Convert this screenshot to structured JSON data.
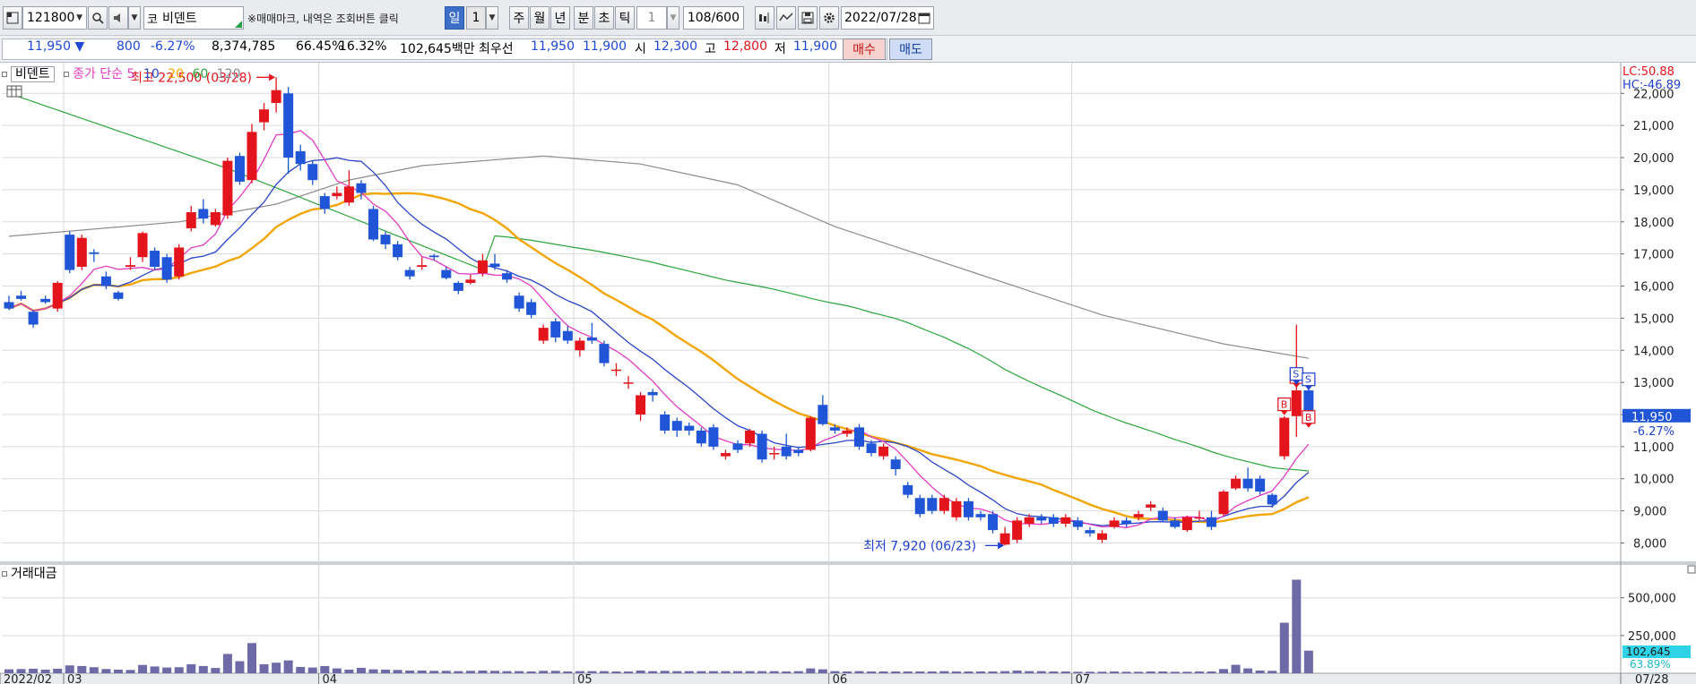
{
  "toolbar": {
    "code": "121800",
    "market_badge": "코",
    "stock_name": "비덴트",
    "mark_text": "매매마크, 내역은 조회버튼 클릭",
    "periods": [
      {
        "label": "일",
        "active": true
      },
      {
        "label": "1",
        "kind": "value"
      },
      {
        "label": "주"
      },
      {
        "label": "월"
      },
      {
        "label": "년"
      },
      {
        "label": "분"
      },
      {
        "label": "초"
      },
      {
        "label": "틱"
      },
      {
        "label": "1",
        "kind": "value-disabled"
      }
    ],
    "count": "108/600",
    "date": "2022/07/28"
  },
  "quote": {
    "price": "11,950",
    "arrow": "▼",
    "change": "800",
    "change_pct": "-6.27%",
    "volume": "8,374,785",
    "ratio1": "66.45%",
    "ratio2": "16.32%",
    "amount": "102,645백만",
    "bid_label": "최우선",
    "bid1": "11,950",
    "bid2": "11,900",
    "open_label": "시",
    "open": "12,300",
    "high_label": "고",
    "high": "12,800",
    "low_label": "저",
    "low": "11,900",
    "buy_label": "매수",
    "sell_label": "매도"
  },
  "legend": {
    "name": "비덴트",
    "ma_label": "종가 단순",
    "periods": [
      "5",
      "10",
      "20",
      "60",
      "120"
    ],
    "volume_label": "거래대금"
  },
  "colors": {
    "up": "#e3141c",
    "down": "#1f55d6",
    "ma5": "#e33cc3",
    "ma10": "#2a45c8",
    "ma20": "#f2a500",
    "ma60": "#2aa53a",
    "ma120": "#8c8c8c",
    "volume": "#6e6aa8"
  },
  "chart_data": {
    "type": "candlestick",
    "y_ticks": [
      "22,000",
      "21,000",
      "20,000",
      "19,000",
      "18,000",
      "17,000",
      "16,000",
      "15,000",
      "14,000",
      "13,000",
      "12,000",
      "11,000",
      "10,000",
      "9,000",
      "8,000"
    ],
    "ylim": [
      7400,
      22900
    ],
    "volume_ticks": [
      "500,000",
      "250,000"
    ],
    "volume_max": 700000,
    "x_labels": [
      {
        "label": "2022/02",
        "i": 0
      },
      {
        "label": "03",
        "i": 5
      },
      {
        "label": "04",
        "i": 26
      },
      {
        "label": "05",
        "i": 47
      },
      {
        "label": "06",
        "i": 68
      },
      {
        "label": "07",
        "i": 88
      },
      {
        "label": "07/28",
        "i": 107
      }
    ],
    "candles": [
      [
        15500,
        15300,
        15700,
        15250
      ],
      [
        15700,
        15600,
        15850,
        15550
      ],
      [
        15200,
        14800,
        15250,
        14700
      ],
      [
        15600,
        15500,
        15700,
        15450
      ],
      [
        15300,
        16100,
        16150,
        15200
      ],
      [
        17600,
        16500,
        17700,
        16400
      ],
      [
        16600,
        17500,
        17600,
        16500
      ],
      [
        17050,
        17000,
        17150,
        16750
      ],
      [
        16300,
        16000,
        16450,
        15900
      ],
      [
        15800,
        15600,
        15850,
        15550
      ],
      [
        16600,
        16650,
        16900,
        16500
      ],
      [
        16900,
        17650,
        17700,
        16750
      ],
      [
        17100,
        16600,
        17200,
        16500
      ],
      [
        16900,
        16200,
        17000,
        16100
      ],
      [
        16300,
        17200,
        17300,
        16200
      ],
      [
        17800,
        18300,
        18500,
        17700
      ],
      [
        18400,
        18100,
        18700,
        17950
      ],
      [
        17900,
        18300,
        18400,
        17850
      ],
      [
        18200,
        19900,
        20000,
        18100
      ],
      [
        20050,
        19250,
        20150,
        19150
      ],
      [
        19300,
        20800,
        21050,
        19200
      ],
      [
        21100,
        21500,
        21700,
        20850
      ],
      [
        21700,
        22100,
        22500,
        21400
      ],
      [
        22000,
        20000,
        22200,
        19500
      ],
      [
        20200,
        19800,
        20400,
        19600
      ],
      [
        19800,
        19300,
        19900,
        19150
      ],
      [
        18800,
        18400,
        18900,
        18250
      ],
      [
        18800,
        18900,
        19100,
        18700
      ],
      [
        18600,
        19100,
        19600,
        18500
      ],
      [
        19200,
        18900,
        19300,
        18700
      ],
      [
        18400,
        17450,
        18500,
        17400
      ],
      [
        17600,
        17300,
        17700,
        17150
      ],
      [
        17300,
        16900,
        17400,
        16800
      ],
      [
        16500,
        16300,
        16600,
        16200
      ],
      [
        16600,
        16650,
        16900,
        16500
      ],
      [
        16950,
        16900,
        17000,
        16800
      ],
      [
        16500,
        16250,
        16600,
        16200
      ],
      [
        16100,
        15850,
        16150,
        15750
      ],
      [
        16100,
        16200,
        16350,
        16050
      ],
      [
        16400,
        16800,
        17000,
        16300
      ],
      [
        16700,
        16600,
        17000,
        16500
      ],
      [
        16400,
        16200,
        16500,
        16100
      ],
      [
        15700,
        15300,
        15800,
        15200
      ],
      [
        15500,
        15100,
        15600,
        15000
      ],
      [
        14300,
        14700,
        14800,
        14200
      ],
      [
        14900,
        14400,
        15000,
        14250
      ],
      [
        14600,
        14300,
        14750,
        14200
      ],
      [
        14000,
        14300,
        14400,
        13800
      ],
      [
        14400,
        14300,
        14850,
        14200
      ],
      [
        14200,
        13600,
        14300,
        13500
      ],
      [
        13400,
        13400,
        13600,
        13200
      ],
      [
        13000,
        13000,
        13200,
        12800
      ],
      [
        12000,
        12600,
        12700,
        11800
      ],
      [
        12700,
        12600,
        12800,
        12400
      ],
      [
        12000,
        11500,
        12100,
        11400
      ],
      [
        11800,
        11500,
        11900,
        11300
      ],
      [
        11650,
        11500,
        11750,
        11350
      ],
      [
        11500,
        11100,
        11600,
        11000
      ],
      [
        11600,
        11000,
        11700,
        10900
      ],
      [
        10700,
        10800,
        10900,
        10600
      ],
      [
        11100,
        10900,
        11200,
        10800
      ],
      [
        11100,
        11500,
        11550,
        11000
      ],
      [
        11400,
        10600,
        11500,
        10500
      ],
      [
        10800,
        10800,
        11000,
        10600
      ],
      [
        11000,
        10700,
        11400,
        10600
      ],
      [
        10900,
        10800,
        11000,
        10700
      ],
      [
        10900,
        11900,
        11950,
        10850
      ],
      [
        12300,
        11700,
        12600,
        11650
      ],
      [
        11600,
        11500,
        11700,
        11400
      ],
      [
        11400,
        11500,
        11600,
        11300
      ],
      [
        11600,
        11000,
        11700,
        10900
      ],
      [
        11100,
        10800,
        11200,
        10700
      ],
      [
        10700,
        11000,
        11100,
        10600
      ],
      [
        10600,
        10300,
        10700,
        10100
      ],
      [
        9800,
        9500,
        9900,
        9400
      ],
      [
        9400,
        8900,
        9500,
        8800
      ],
      [
        9400,
        9000,
        9500,
        8900
      ],
      [
        9000,
        9400,
        9500,
        8900
      ],
      [
        8800,
        9300,
        9400,
        8700
      ],
      [
        9300,
        8800,
        9400,
        8700
      ],
      [
        8900,
        8800,
        9000,
        8700
      ],
      [
        8900,
        8400,
        9000,
        8300
      ],
      [
        7950,
        8300,
        8500,
        7920
      ],
      [
        8100,
        8700,
        8800,
        8000
      ],
      [
        8600,
        8800,
        8900,
        8500
      ],
      [
        8800,
        8700,
        8900,
        8600
      ],
      [
        8800,
        8600,
        8900,
        8500
      ],
      [
        8600,
        8800,
        8900,
        8500
      ],
      [
        8700,
        8500,
        8800,
        8400
      ],
      [
        8400,
        8300,
        8500,
        8200
      ],
      [
        8100,
        8300,
        8400,
        8000
      ],
      [
        8500,
        8700,
        8800,
        8450
      ],
      [
        8700,
        8600,
        8800,
        8500
      ],
      [
        8800,
        8900,
        9000,
        8700
      ],
      [
        9100,
        9200,
        9300,
        9000
      ],
      [
        9000,
        8700,
        9100,
        8650
      ],
      [
        8700,
        8500,
        8800,
        8450
      ],
      [
        8400,
        8800,
        8850,
        8350
      ],
      [
        8800,
        8800,
        9000,
        8700
      ],
      [
        8800,
        8500,
        9000,
        8400
      ],
      [
        8900,
        9600,
        9650,
        8850
      ],
      [
        9700,
        10000,
        10100,
        9650
      ],
      [
        10000,
        9700,
        10350,
        9600
      ],
      [
        10000,
        9600,
        10100,
        9500
      ],
      [
        9500,
        9200,
        9550,
        9100
      ],
      [
        10700,
        11900,
        11950,
        10600
      ],
      [
        11950,
        12750,
        14800,
        11300
      ],
      [
        12750,
        11950,
        12800,
        11900
      ]
    ],
    "volumes": [
      26000,
      28000,
      30000,
      24000,
      30000,
      52000,
      48000,
      40000,
      28000,
      24000,
      22000,
      55000,
      45000,
      38000,
      40000,
      60000,
      48000,
      35000,
      128000,
      80000,
      200000,
      60000,
      70000,
      85000,
      42000,
      38000,
      48000,
      32000,
      24000,
      36000,
      26000,
      24000,
      22000,
      18000,
      18000,
      16000,
      16000,
      14000,
      16000,
      18000,
      16000,
      14000,
      14000,
      12000,
      16000,
      16000,
      12000,
      14000,
      14000,
      14000,
      12000,
      12000,
      18000,
      14000,
      16000,
      14000,
      14000,
      14000,
      14000,
      14000,
      14000,
      14000,
      14000,
      14000,
      12000,
      14000,
      32000,
      26000,
      14000,
      12000,
      14000,
      12000,
      12000,
      12000,
      12000,
      12000,
      12000,
      14000,
      12000,
      12000,
      12000,
      12000,
      14000,
      18000,
      14000,
      14000,
      12000,
      12000,
      10000,
      10000,
      10000,
      12000,
      10000,
      10000,
      12000,
      12000,
      10000,
      10000,
      12000,
      12000,
      28000,
      56000,
      32000,
      18000,
      16000,
      335000,
      620000,
      150000
    ],
    "ma120": [
      [
        0,
        17550
      ],
      [
        14,
        18000
      ],
      [
        22,
        18550
      ],
      [
        28,
        19300
      ],
      [
        34,
        19750
      ],
      [
        44,
        20050
      ],
      [
        52,
        19800
      ],
      [
        60,
        19150
      ],
      [
        68,
        17850
      ],
      [
        80,
        16350
      ],
      [
        90,
        15100
      ],
      [
        100,
        14200
      ],
      [
        107,
        13750
      ]
    ],
    "annotations": {
      "high": {
        "label": "최고 22,500 (03/28)",
        "i": 22,
        "value": 22500
      },
      "low": {
        "label": "최저 7,920 (06/23)",
        "i": 82,
        "value": 7920
      },
      "current": {
        "price": "11,950",
        "pct": "-6.27%"
      },
      "lc": "LC:50.88",
      "hc": "HC:-46.89",
      "volume_current": "102,645",
      "volume_pct": "63.89%",
      "markers": [
        {
          "i": 105,
          "type": "B"
        },
        {
          "i": 106,
          "type": "B"
        },
        {
          "i": 107,
          "type": "B"
        },
        {
          "i": 106,
          "type": "S"
        },
        {
          "i": 107,
          "type": "S"
        }
      ]
    }
  }
}
